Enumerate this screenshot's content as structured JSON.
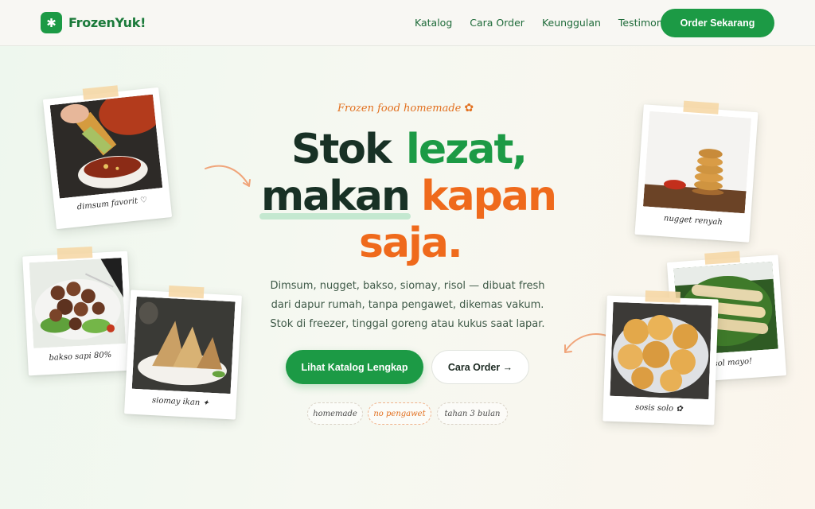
{
  "brand": {
    "mark": "✱",
    "name": "FrozenYuk!"
  },
  "nav": {
    "links": [
      "Katalog",
      "Cara Order",
      "Keunggulan",
      "Testimoni"
    ],
    "cta": "Order Sekarang"
  },
  "hero": {
    "eyebrow": "Frozen food homemade",
    "eyebrow_icon": "flower-icon",
    "headline": {
      "w1": "Stok",
      "w2": "lezat,",
      "w3": "makan",
      "w4": "kapan",
      "w5": "saja."
    },
    "lead": "Dimsum, nugget, bakso, siomay, risol — dibuat fresh dari dapur rumah, tanpa pengawet, dikemas vakum. Stok di freezer, tinggal goreng atau kukus saat lapar.",
    "primary_button": "Lihat Katalog Lengkap",
    "secondary_button": "Cara Order →",
    "chips": [
      "homemade",
      "no pengawet",
      "tahan 3 bulan"
    ]
  },
  "polaroids": [
    {
      "caption": "dimsum favorit ♡"
    },
    {
      "caption": "bakso sapi 80%"
    },
    {
      "caption": "siomay ikan ✦"
    },
    {
      "caption": "nugget renyah"
    },
    {
      "caption": "risol mayo!"
    },
    {
      "caption": "sosis solo ✿"
    }
  ],
  "colors": {
    "green": "#1c9a45",
    "dark": "#183125",
    "orange": "#ef6a1c",
    "tape": "#f6d6a2"
  }
}
